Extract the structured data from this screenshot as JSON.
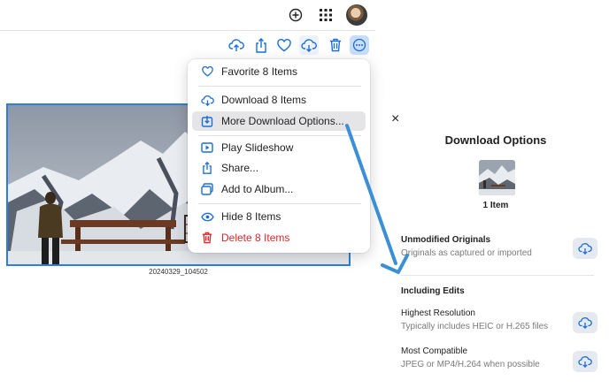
{
  "toolbar": {
    "top_icons": [
      "add-circle-icon",
      "grid-icon",
      "avatar"
    ],
    "actions": [
      "cloud-upload-icon",
      "share-icon",
      "heart-icon",
      "cloud-download-icon",
      "trash-icon",
      "more-icon"
    ]
  },
  "photo": {
    "caption": "20240329_104502"
  },
  "menu": {
    "items": [
      {
        "label": "Favorite 8 Items",
        "icon": "heart-icon"
      },
      {
        "label": "Download 8 Items",
        "icon": "cloud-download-icon"
      },
      {
        "label": "More Download Options...",
        "icon": "download-options-icon"
      },
      {
        "label": "Play Slideshow",
        "icon": "play-icon"
      },
      {
        "label": "Share...",
        "icon": "share-icon"
      },
      {
        "label": "Add to Album...",
        "icon": "album-icon"
      },
      {
        "label": "Hide 8 Items",
        "icon": "eye-icon"
      },
      {
        "label": "Delete 8 Items",
        "icon": "trash-icon"
      }
    ]
  },
  "panel": {
    "close": "×",
    "title": "Download Options",
    "count": "1 Item",
    "unmodified": {
      "title": "Unmodified Originals",
      "subtitle": "Originals as captured or imported"
    },
    "section": "Including Edits",
    "highest": {
      "title": "Highest Resolution",
      "subtitle": "Typically includes HEIC or H.265 files"
    },
    "compatible": {
      "title": "Most Compatible",
      "subtitle": "JPEG or MP4/H.264 when possible"
    }
  },
  "colors": {
    "accent": "#1a6ed8",
    "danger": "#e0262b",
    "arrow": "#3a8fd6"
  }
}
